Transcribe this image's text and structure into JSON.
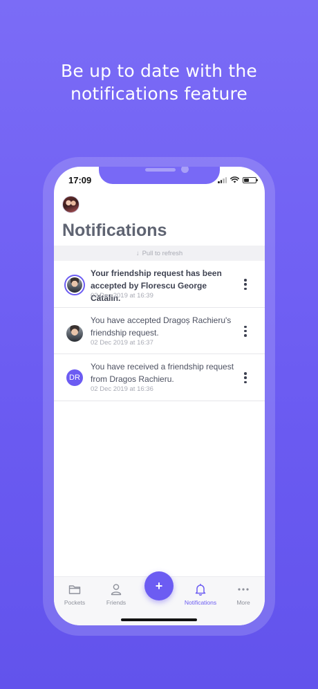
{
  "headline": {
    "line1": "Be up to date with the",
    "line2": "notifications feature"
  },
  "status_bar": {
    "time": "17:09",
    "icons": [
      "signal-icon",
      "wifi-icon",
      "battery-icon"
    ]
  },
  "header": {
    "title": "Notifications",
    "avatar": "user-avatar"
  },
  "pull_to_refresh": {
    "icon": "arrow-down-icon",
    "label": "Pull to refresh"
  },
  "notifications": [
    {
      "text": "Your friendship request has been accepted by Florescu George Cătălin.",
      "time": "02 Dec 2019 at 16:39",
      "unread": true,
      "avatar": "photo"
    },
    {
      "text": "You have accepted Dragoș Rachieru's friendship request.",
      "time": "02 Dec 2019 at 16:37",
      "unread": false,
      "avatar": "photo"
    },
    {
      "text": "You have received a friendship request from Dragos Rachieru.",
      "time": "02 Dec 2019 at 16:36",
      "unread": false,
      "avatar": "initials",
      "initials": "DR"
    }
  ],
  "tab_bar": {
    "tabs": [
      {
        "label": "Pockets",
        "icon": "folder-icon",
        "active": false
      },
      {
        "label": "Friends",
        "icon": "person-icon",
        "active": false
      },
      {
        "label": "Notifications",
        "icon": "bell-icon",
        "active": true
      },
      {
        "label": "More",
        "icon": "more-dots-icon",
        "active": false
      }
    ],
    "fab_symbol": "+"
  },
  "colors": {
    "accent": "#6c5cf2",
    "background": "#7366f4",
    "text": "#4c5060",
    "muted": "#a8aab4"
  }
}
